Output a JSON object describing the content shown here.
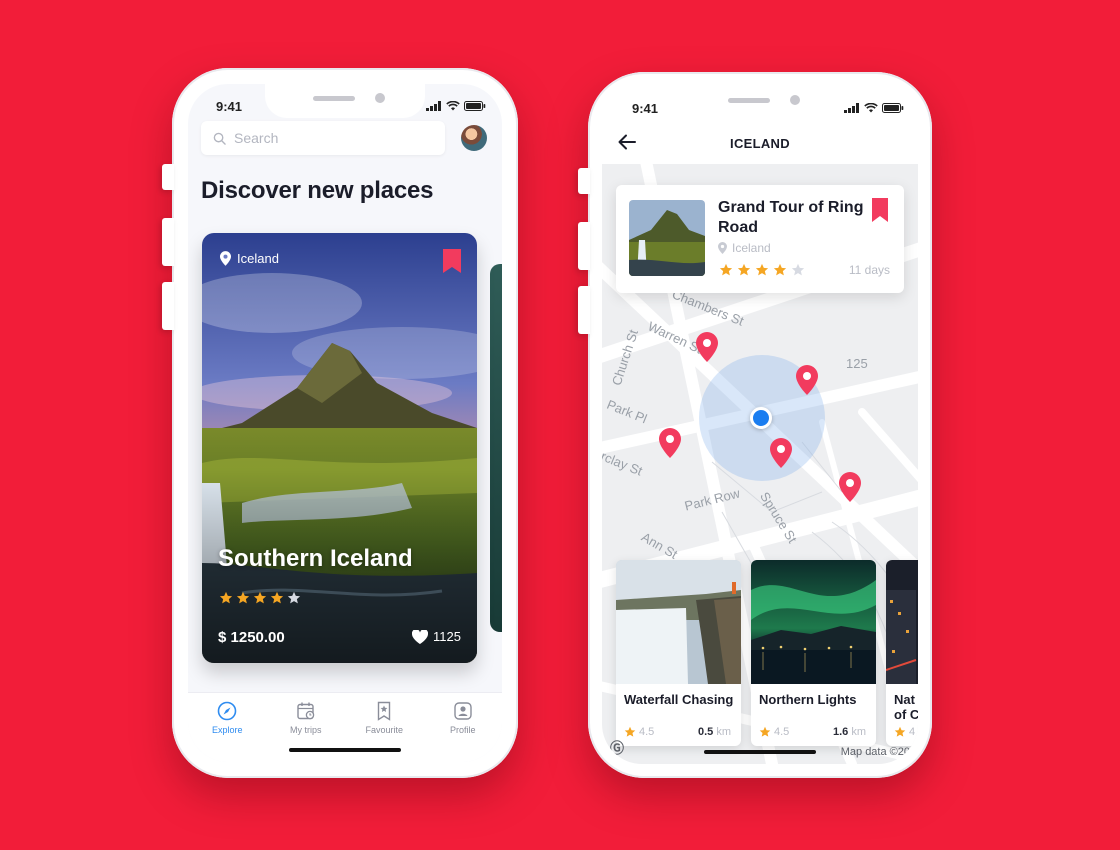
{
  "colors": {
    "background": "#F21D39",
    "accent": "#F23B5E",
    "active_tab": "#2F8CF0",
    "star": "#F5A623"
  },
  "phone1": {
    "status": {
      "time": "9:41"
    },
    "search": {
      "placeholder": "Search"
    },
    "headline": "Discover new places",
    "card": {
      "location": "Iceland",
      "title": "Southern Iceland",
      "rating": 4,
      "rating_max": 5,
      "price": "$ 1250.00",
      "likes": "1125"
    },
    "tabs": [
      {
        "label": "Explore",
        "icon": "compass-icon",
        "active": true
      },
      {
        "label": "My trips",
        "icon": "calendar-icon",
        "active": false
      },
      {
        "label": "Favourite",
        "icon": "bookmark-star-icon",
        "active": false
      },
      {
        "label": "Profile",
        "icon": "profile-icon",
        "active": false
      }
    ]
  },
  "phone2": {
    "status": {
      "time": "9:41"
    },
    "header": {
      "title": "ICELAND",
      "back_icon": "arrow-left-icon"
    },
    "tour": {
      "title": "Grand Tour of Ring Road",
      "location": "Iceland",
      "rating": 4,
      "rating_max": 5,
      "duration": "11 days"
    },
    "map": {
      "streets": [
        "Chambers St",
        "Warren St",
        "Church St",
        "Park Pl",
        "rclay St",
        "Park Row",
        "Spruce St",
        "Ann St",
        "125"
      ],
      "credit": "Map data ©20",
      "pins": 5
    },
    "places": [
      {
        "title": "Waterfall Chasing",
        "rating": "4.5",
        "distance_value": "0.5",
        "distance_unit": "km"
      },
      {
        "title": "Northern Lights",
        "rating": "4.5",
        "distance_value": "1.6",
        "distance_unit": "km"
      },
      {
        "title_lines": [
          "Nat",
          "of C"
        ],
        "rating": "4"
      }
    ]
  }
}
